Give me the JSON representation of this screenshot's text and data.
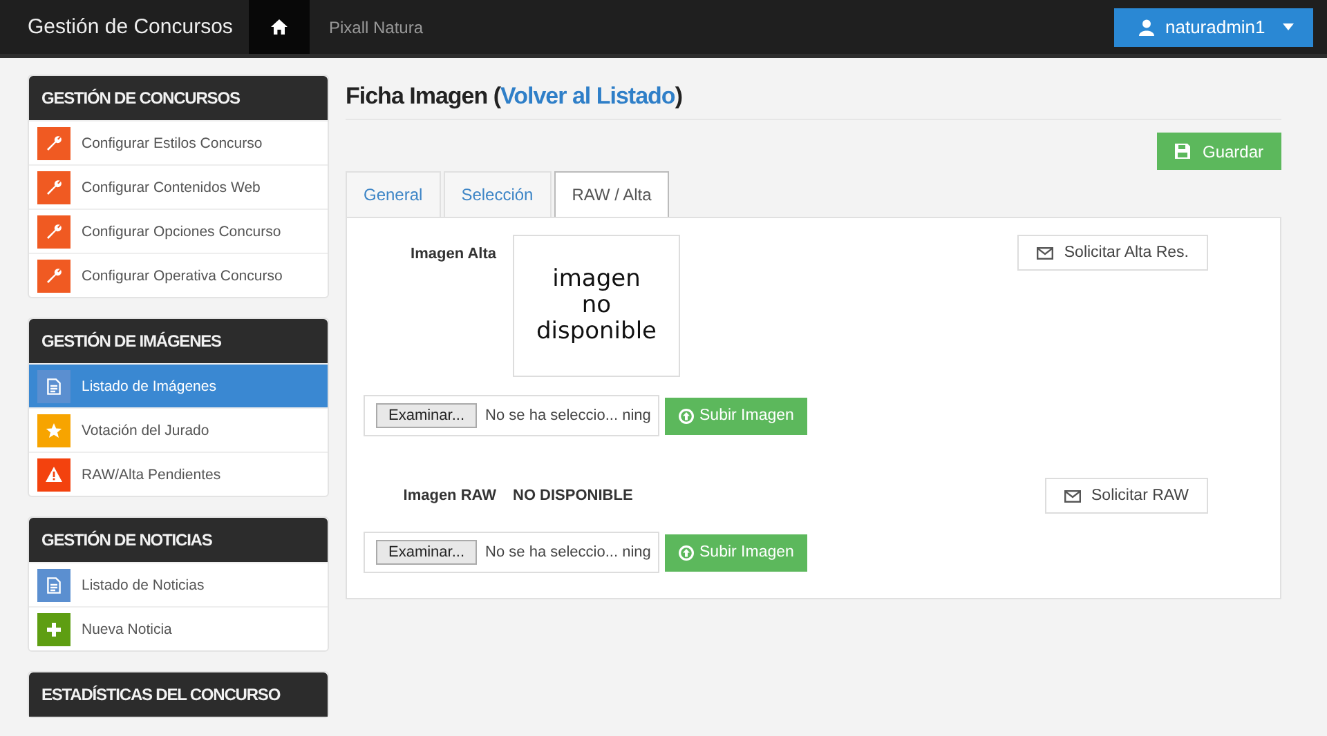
{
  "navbar": {
    "brand": "Gestión de Concursos",
    "home_selected": true,
    "breadcrumb": "Pixall Natura",
    "user": "naturadmin1"
  },
  "sidebar": [
    {
      "title": "GESTIÓN DE CONCURSOS",
      "items": [
        {
          "label": "Configurar Estilos Concurso",
          "kind": "wrench",
          "color": "#f05a22",
          "selected": false
        },
        {
          "label": "Configurar Contenidos Web",
          "kind": "wrench",
          "color": "#f05a22",
          "selected": false
        },
        {
          "label": "Configurar Opciones Concurso",
          "kind": "wrench",
          "color": "#f05a22",
          "selected": false
        },
        {
          "label": "Configurar Operativa Concurso",
          "kind": "wrench",
          "color": "#f05a22",
          "selected": false
        }
      ]
    },
    {
      "title": "GESTIÓN DE IMÁGENES",
      "items": [
        {
          "label": "Listado de Imágenes",
          "kind": "document",
          "color": "#5b8fd0",
          "selected": true
        },
        {
          "label": "Votación del Jurado",
          "kind": "star",
          "color": "#f7a400",
          "selected": false
        },
        {
          "label": "RAW/Alta Pendientes",
          "kind": "warning",
          "color": "#f3420e",
          "selected": false
        }
      ]
    },
    {
      "title": "GESTIÓN DE NOTICIAS",
      "items": [
        {
          "label": "Listado de Noticias",
          "kind": "document",
          "color": "#5b8fd0",
          "selected": false
        },
        {
          "label": "Nueva Noticia",
          "kind": "plus",
          "color": "#5e9e12",
          "selected": false
        }
      ]
    },
    {
      "title": "ESTADÍSTICAS DEL CONCURSO"
    }
  ],
  "page": {
    "title": "Ficha Imagen (",
    "link": "Volver al Listado",
    "title_end": ")",
    "save_button": "Guardar",
    "tabs": [
      {
        "label": "General",
        "selected": false
      },
      {
        "label": "Selección",
        "selected": false
      },
      {
        "label": "RAW / Alta",
        "selected": true
      }
    ],
    "sections": [
      {
        "kind": "image",
        "label": "Imagen Alta",
        "image_text": [
          "imagen",
          "no",
          "disponible"
        ],
        "request_button": "Solicitar Alta Res.",
        "browse_button": "Examinar...",
        "file_name": "No se ha seleccio... ning",
        "upload_button": "Subir Imagen"
      },
      {
        "kind": "status",
        "label": "Imagen RAW",
        "status": "NO DISPONIBLE",
        "request_button": "Solicitar RAW",
        "browse_button": "Examinar...",
        "file_name": "No se ha seleccio... ning",
        "upload_button": "Subir Imagen"
      }
    ]
  }
}
